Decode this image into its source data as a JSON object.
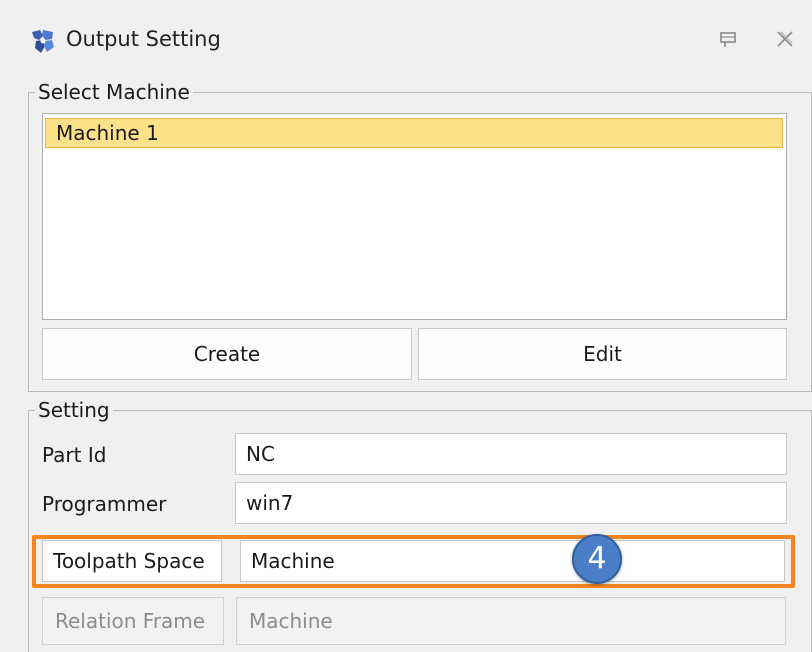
{
  "window": {
    "title": "Output Setting",
    "app_icon": "app-logo-icon",
    "pin_icon": "pin-icon",
    "close_icon": "close-icon"
  },
  "select_machine": {
    "legend": "Select Machine",
    "items": [
      "Machine 1"
    ],
    "selected_index": 0,
    "selected_color": "#fde28a",
    "create_label": "Create",
    "edit_label": "Edit"
  },
  "setting": {
    "legend": "Setting",
    "part_id_label": "Part Id",
    "part_id_value": "NC",
    "programmer_label": "Programmer",
    "programmer_value": "win7",
    "toolpath_space_label": "Toolpath Space",
    "toolpath_space_value": "Machine",
    "relation_frame_label": "Relation Frame",
    "relation_frame_value": "Machine"
  },
  "annotation": {
    "badge_number": "4",
    "highlight_color": "#f5841f",
    "badge_color": "#4a7fc8"
  }
}
